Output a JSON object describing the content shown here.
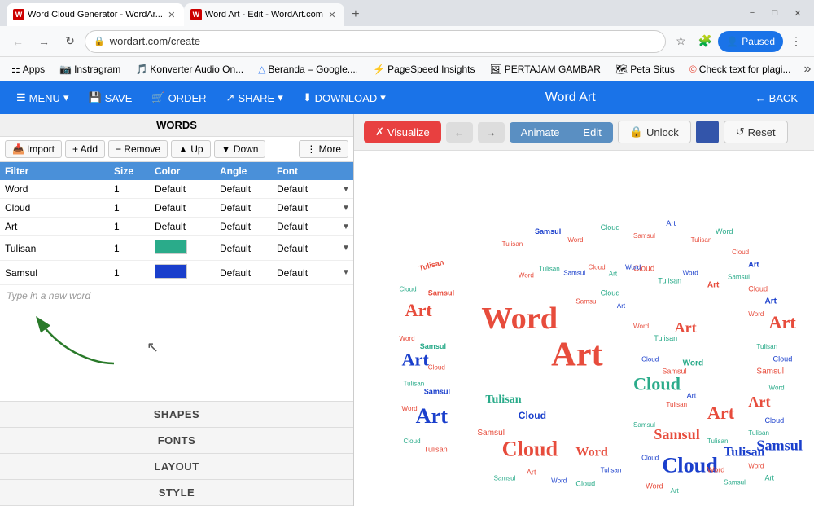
{
  "browser": {
    "tabs": [
      {
        "id": "tab1",
        "favicon_color": "#cc0000",
        "favicon_text": "W",
        "title": "Word Cloud Generator - WordAr...",
        "active": true
      },
      {
        "id": "tab2",
        "favicon_color": "#cc0000",
        "favicon_text": "W",
        "title": "Word Art - Edit - WordArt.com",
        "active": false
      }
    ],
    "new_tab_label": "+",
    "nav": {
      "back_label": "←",
      "forward_label": "→",
      "refresh_label": "↻",
      "address": "wordart.com/create",
      "lock_icon": "🔒"
    },
    "nav_icons": {
      "bookmark_star": "☆",
      "extensions": "🧩",
      "profile": "👤",
      "paused_label": "Paused",
      "menu": "⋮"
    },
    "bookmarks": [
      {
        "label": "Apps",
        "icon": "⚏"
      },
      {
        "label": "Instragram",
        "icon": "📷"
      },
      {
        "label": "Konverter Audio On...",
        "icon": "🎵"
      },
      {
        "label": "Beranda – Google....",
        "icon": "△"
      },
      {
        "label": "PageSpeed Insights",
        "icon": "⚡"
      },
      {
        "label": "PERTAJAM GAMBAR",
        "icon": "🖼"
      },
      {
        "label": "Peta Situs",
        "icon": "🗺"
      },
      {
        "label": "Check text for plagi...",
        "icon": "©"
      }
    ]
  },
  "app_toolbar": {
    "menu_label": "MENU",
    "save_label": "SAVE",
    "order_label": "ORDER",
    "share_label": "SHARE",
    "download_label": "DOWNLOAD",
    "title": "Word Art",
    "back_label": "BACK"
  },
  "left_panel": {
    "words_header": "WORDS",
    "toolbar_buttons": {
      "import": "Import",
      "add": "+ Add",
      "remove": "− Remove",
      "up": "▲ Up",
      "down": "▼ Down",
      "more": "⋮ More"
    },
    "table_headers": {
      "filter": "Filter",
      "size": "Size",
      "color": "Color",
      "angle": "Angle",
      "font": "Font"
    },
    "words": [
      {
        "word": "Word",
        "size": "1",
        "color_label": "Default",
        "color_hex": null,
        "angle": "Default",
        "font": "Default"
      },
      {
        "word": "Cloud",
        "size": "1",
        "color_label": "Default",
        "color_hex": null,
        "angle": "Default",
        "font": "Default"
      },
      {
        "word": "Art",
        "size": "1",
        "color_label": "Default",
        "color_hex": null,
        "angle": "Default",
        "font": "Default"
      },
      {
        "word": "Tulisan",
        "size": "1",
        "color_label": "",
        "color_hex": "#2aab8a",
        "angle": "Default",
        "font": "Default"
      },
      {
        "word": "Samsul",
        "size": "1",
        "color_label": "",
        "color_hex": "#1a3fcc",
        "angle": "Default",
        "font": "Default"
      }
    ],
    "new_word_placeholder": "Type in a new word",
    "sections": [
      {
        "label": "SHAPES"
      },
      {
        "label": "FONTS"
      },
      {
        "label": "LAYOUT"
      },
      {
        "label": "STYLE"
      }
    ]
  },
  "visualize_toolbar": {
    "visualize_label": "✗ Visualize",
    "back_arrow": "←",
    "forward_arrow": "→",
    "animate_label": "Animate",
    "edit_label": "Edit",
    "lock_icon": "🔒",
    "unlock_label": "Unlock",
    "reset_label": "↺ Reset"
  }
}
